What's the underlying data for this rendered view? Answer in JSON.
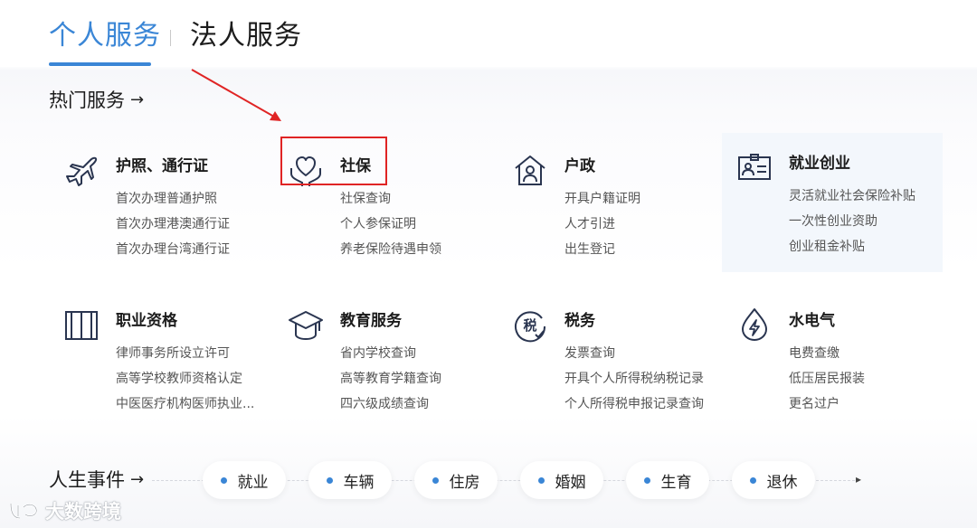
{
  "tabs": {
    "personal": "个人服务",
    "legal": "法人服务"
  },
  "hot": {
    "title": "热门服务",
    "arrow": "→"
  },
  "services": [
    {
      "title": "护照、通行证",
      "icon": "airplane-icon",
      "links": [
        "首次办理普通护照",
        "首次办理港澳通行证",
        "首次办理台湾通行证"
      ]
    },
    {
      "title": "社保",
      "icon": "heart-hands-icon",
      "links": [
        "社保查询",
        "个人参保证明",
        "养老保险待遇申领"
      ]
    },
    {
      "title": "户政",
      "icon": "house-person-icon",
      "links": [
        "开具户籍证明",
        "人才引进",
        "出生登记"
      ]
    },
    {
      "title": "就业创业",
      "icon": "id-card-icon",
      "links": [
        "灵活就业社会保险补贴",
        "一次性创业资助",
        "创业租金补贴"
      ]
    },
    {
      "title": "职业资格",
      "icon": "book-icon",
      "links": [
        "律师事务所设立许可",
        "高等学校教师资格认定",
        "中医医疗机构医师执业..."
      ]
    },
    {
      "title": "教育服务",
      "icon": "graduation-cap-icon",
      "links": [
        "省内学校查询",
        "高等教育学籍查询",
        "四六级成绩查询"
      ]
    },
    {
      "title": "税务",
      "icon": "tax-icon",
      "links": [
        "发票查询",
        "开具个人所得税纳税记录",
        "个人所得税申报记录查询"
      ]
    },
    {
      "title": "水电气",
      "icon": "lightning-drop-icon",
      "links": [
        "电费查缴",
        "低压居民报装",
        "更名过户"
      ]
    }
  ],
  "life": {
    "title": "人生事件",
    "arrow": "→",
    "end": "▸",
    "events": [
      "就业",
      "车辆",
      "住房",
      "婚姻",
      "生育",
      "退休"
    ]
  },
  "watermark": "大数跨境",
  "colors": {
    "accent": "#3a86d6",
    "annotation": "#e02424",
    "highlight": "#f3f7fc"
  }
}
